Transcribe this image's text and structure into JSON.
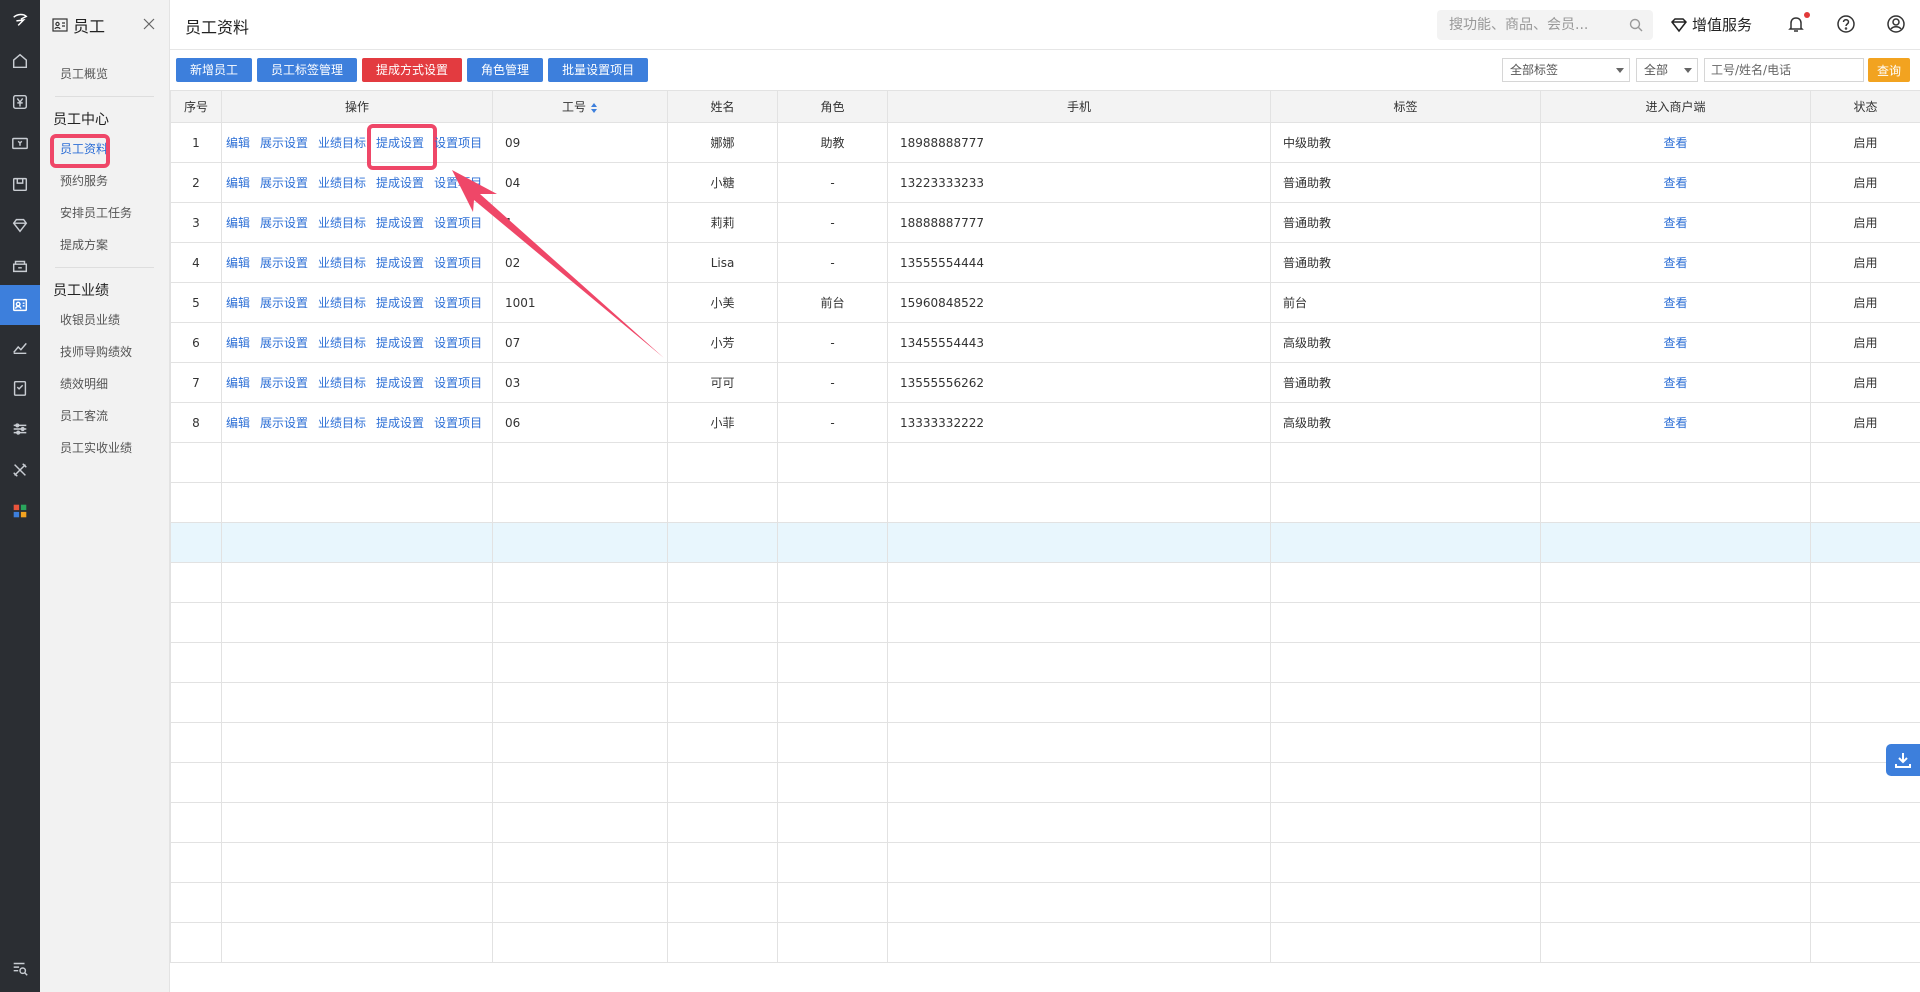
{
  "sidebar": {
    "title": "员工",
    "items": [
      {
        "label": "员工概览"
      },
      {
        "group": "员工中心"
      },
      {
        "label": "员工资料",
        "active": true
      },
      {
        "label": "预约服务"
      },
      {
        "label": "安排员工任务"
      },
      {
        "label": "提成方案"
      },
      {
        "group": "员工业绩"
      },
      {
        "label": "收银员业绩"
      },
      {
        "label": "技师导购绩效"
      },
      {
        "label": "绩效明细"
      },
      {
        "label": "员工客流"
      },
      {
        "label": "员工实收业绩"
      }
    ]
  },
  "header": {
    "title": "员工资料",
    "search_placeholder": "搜功能、商品、会员...",
    "value_service": "增值服务"
  },
  "toolbar": {
    "buttons": [
      "新增员工",
      "员工标签管理",
      "提成方式设置",
      "角色管理",
      "批量设置项目"
    ],
    "tag_select": "全部标签",
    "status_select": "全部",
    "keyword_placeholder": "工号/姓名/电话",
    "query": "查询"
  },
  "table": {
    "headers": [
      "序号",
      "操作",
      "工号",
      "姓名",
      "角色",
      "手机",
      "标签",
      "进入商户端",
      "状态"
    ],
    "ops": [
      "编辑",
      "展示设置",
      "业绩目标",
      "提成设置",
      "设置项目"
    ],
    "view_label": "查看",
    "rows": [
      {
        "no": "1",
        "id": "09",
        "name": "娜娜",
        "role": "助教",
        "phone": "18988888777",
        "tag": "中级助教",
        "status": "启用"
      },
      {
        "no": "2",
        "id": "04",
        "name": "小糖",
        "role": "-",
        "phone": "13223333233",
        "tag": "普通助教",
        "status": "启用"
      },
      {
        "no": "3",
        "id": "1",
        "name": "莉莉",
        "role": "-",
        "phone": "18888887777",
        "tag": "普通助教",
        "status": "启用"
      },
      {
        "no": "4",
        "id": "02",
        "name": "Lisa",
        "role": "-",
        "phone": "13555554444",
        "tag": "普通助教",
        "status": "启用"
      },
      {
        "no": "5",
        "id": "1001",
        "name": "小美",
        "role": "前台",
        "phone": "15960848522",
        "tag": "前台",
        "status": "启用"
      },
      {
        "no": "6",
        "id": "07",
        "name": "小芳",
        "role": "-",
        "phone": "13455554443",
        "tag": "高级助教",
        "status": "启用"
      },
      {
        "no": "7",
        "id": "03",
        "name": "可可",
        "role": "-",
        "phone": "13555556262",
        "tag": "普通助教",
        "status": "启用"
      },
      {
        "no": "8",
        "id": "06",
        "name": "小菲",
        "role": "-",
        "phone": "13333332222",
        "tag": "高级助教",
        "status": "启用"
      }
    ],
    "empty_rows": 13,
    "hover_empty_row": 3
  },
  "colors": {
    "primary": "#3d7fdc",
    "danger": "#e33b40",
    "query": "#f2a320",
    "highlight": "#ef4768",
    "rail": "#2b2e33"
  },
  "icons": [
    "logo-icon",
    "home-icon",
    "yen-icon",
    "money-icon",
    "box-icon",
    "diamond-icon",
    "store-icon",
    "staff-icon",
    "chart-icon",
    "report-icon",
    "sliders-icon",
    "tools-icon",
    "apps-icon",
    "search-list-icon"
  ]
}
